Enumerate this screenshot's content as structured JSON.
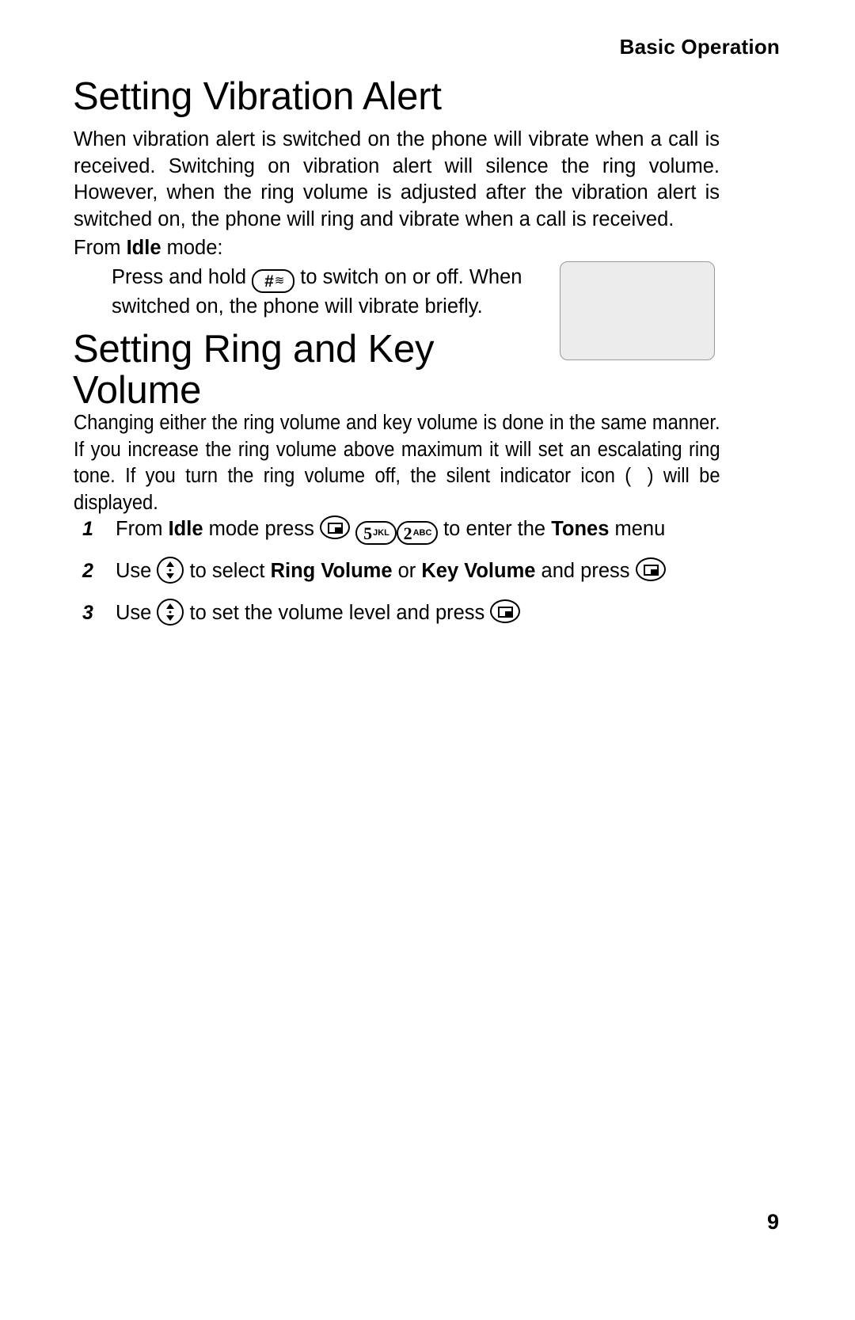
{
  "header": {
    "running_head": "Basic Operation"
  },
  "sections": [
    {
      "heading": "Setting Vibration Alert",
      "paragraph": "When vibration alert is switched on the phone will vibrate when a call is received. Switching on vibration alert will silence the ring volume. However, when the ring volume is adjusted after the vibration alert is switched on, the phone will ring and vibrate when a call is received.",
      "mode_line_prefix": "From ",
      "mode_line_bold": "Idle",
      "mode_line_suffix": " mode:",
      "indent_prefix": "Press and hold ",
      "indent_suffix": " to switch on or off. When switched on, the phone will vibrate briefly.",
      "hash_key": {
        "symbol": "#",
        "wave": "≋",
        "name": "hash-key"
      }
    },
    {
      "heading": "Setting Ring and Key\nVolume",
      "paragraph_part1": "Changing either the ring volume and key volume is done in the same manner. If you increase the ring volume above maximum it will set an escalating ring tone. If you turn the ring volume off, the silent indicator icon (",
      "paragraph_part2": ") will be displayed."
    }
  ],
  "illustration": {
    "name": "phone-display-vibrate",
    "icon_label": "vibrate-silent-indicator",
    "background_color": "#ececec",
    "border_color": "#9a9a9a"
  },
  "steps": [
    {
      "number": "1",
      "text_1": "From ",
      "bold_1": "Idle",
      "text_2": " mode press ",
      "keys": [
        {
          "type": "menu",
          "name": "menu-key"
        },
        {
          "type": "num",
          "digit": "5",
          "letters": "JKL",
          "name": "key-5"
        },
        {
          "type": "num",
          "digit": "2",
          "letters": "ABC",
          "name": "key-2"
        }
      ],
      "text_3": " to enter the ",
      "bold_2": "Tones",
      "text_4": " menu"
    },
    {
      "number": "2",
      "text_1": "Use ",
      "nav_key": {
        "type": "nav",
        "name": "navigation-key"
      },
      "text_2": " to select ",
      "bold_1": "Ring Volume",
      "text_3": " or ",
      "bold_2": "Key Volume",
      "text_4": " and press ",
      "end_key": {
        "type": "menu",
        "name": "menu-key"
      }
    },
    {
      "number": "3",
      "text_1": "Use ",
      "nav_key": {
        "type": "nav",
        "name": "navigation-key"
      },
      "text_2": " to set the volume level and press ",
      "end_key": {
        "type": "menu",
        "name": "menu-key"
      }
    }
  ],
  "footer": {
    "page_number": "9"
  }
}
